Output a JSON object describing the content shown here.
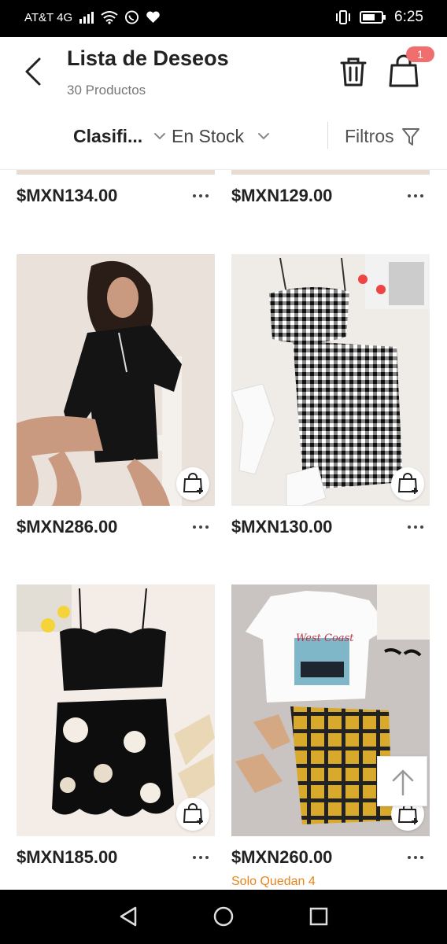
{
  "status_bar": {
    "carrier": "AT&T 4G",
    "time": "6:25",
    "icons": [
      "signal-icon",
      "wifi-icon",
      "whatsapp-icon",
      "heart-icon",
      "vibrate-icon",
      "battery-icon"
    ]
  },
  "header": {
    "title": "Lista de Deseos",
    "subtitle": "30 Productos",
    "cart_count": "1"
  },
  "filter_bar": {
    "sort_label": "Clasifi...",
    "stock_label": "En Stock",
    "filters_label": "Filtros"
  },
  "products_partial": [
    {
      "price": "$MXN134.00"
    },
    {
      "price": "$MXN129.00"
    }
  ],
  "products": [
    {
      "price": "$MXN286.00",
      "image": "black satin pajama set"
    },
    {
      "price": "$MXN130.00",
      "image": "gingham cami and skirt set"
    },
    {
      "price": "$MXN185.00",
      "image": "black scalloped cami and floral skirt"
    },
    {
      "price": "$MXN260.00",
      "image": "car graphic tee and plaid skirt",
      "stock_note": "Solo Quedan 4"
    }
  ],
  "colors": {
    "accent_orange": "#e8841a",
    "badge": "#f06e6e"
  }
}
